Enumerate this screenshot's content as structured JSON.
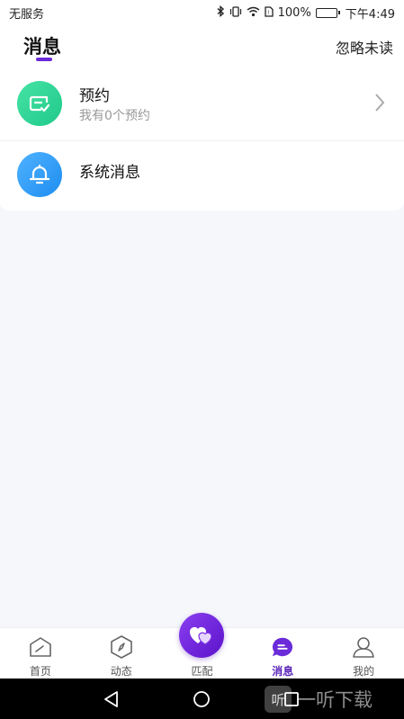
{
  "status_bar": {
    "carrier": "无服务",
    "battery_text": "100%",
    "time": "下午4:49",
    "icons": [
      "bluetooth-icon",
      "vibrate-icon",
      "wifi-icon",
      "sim-icon",
      "battery-icon"
    ]
  },
  "header": {
    "title": "消息",
    "ignore_unread": "忽略未读",
    "accent_color": "#6b2bd9"
  },
  "messages": [
    {
      "title": "预约",
      "subtitle": "我有0个预约",
      "icon": "calendar-check-icon",
      "color": "#1fc98a"
    },
    {
      "title": "系统消息",
      "subtitle": "",
      "icon": "bell-icon",
      "color": "#1e8df0"
    }
  ],
  "bottom_nav": {
    "items": [
      {
        "label": "首页",
        "icon": "home-icon"
      },
      {
        "label": "动态",
        "icon": "compass-icon"
      },
      {
        "label": "匹配",
        "icon": "heart-match-icon"
      },
      {
        "label": "消息",
        "icon": "message-icon"
      },
      {
        "label": "我的",
        "icon": "profile-icon"
      }
    ],
    "active_index": 3
  },
  "system_bar": {
    "watermark": "一听下载",
    "watermark_logo": "听"
  }
}
